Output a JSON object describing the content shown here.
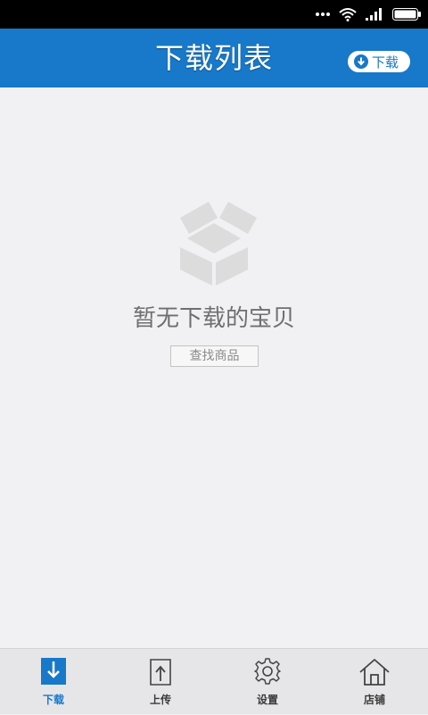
{
  "status_bar": {
    "icons": [
      "dots-icon",
      "wifi-icon",
      "signal-icon",
      "battery-icon"
    ]
  },
  "header": {
    "title": "下载列表",
    "download_button_label": "下载"
  },
  "empty_state": {
    "message": "暂无下载的宝贝",
    "find_button_label": "查找商品"
  },
  "tabs": [
    {
      "label": "下载",
      "icon": "download-icon",
      "active": true
    },
    {
      "label": "上传",
      "icon": "upload-icon",
      "active": false
    },
    {
      "label": "设置",
      "icon": "gear-icon",
      "active": false
    },
    {
      "label": "店铺",
      "icon": "home-icon",
      "active": false
    }
  ],
  "colors": {
    "brand": "#1878c9",
    "background": "#f1f0f3",
    "tabbar": "#e6e6e9"
  }
}
